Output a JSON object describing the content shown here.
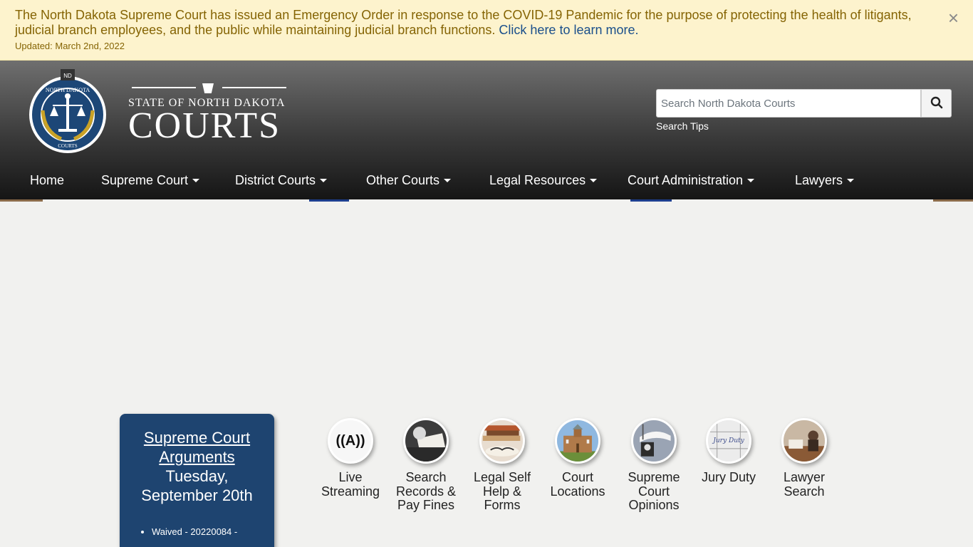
{
  "alert": {
    "message": "The North Dakota Supreme Court has issued an Emergency Order in response to the COVID-19 Pandemic for the purpose of protecting the health of litigants, judicial branch employees, and the public while maintaining judicial branch functions.",
    "link_text": "Click here to learn more.",
    "updated": "Updated: March 2nd, 2022",
    "close_glyph": "×"
  },
  "logo": {
    "seal_top": "NORTH DAKOTA",
    "seal_bottom": "COURTS",
    "seal_badge": "ND",
    "state_line": "STATE OF NORTH DAKOTA",
    "courts_line": "COURTS"
  },
  "search": {
    "placeholder": "Search North Dakota Courts",
    "tips": "Search Tips",
    "icon": "search-icon"
  },
  "nav": [
    {
      "label": "Home",
      "dropdown": false
    },
    {
      "label": "Supreme Court",
      "dropdown": true
    },
    {
      "label": "District Courts",
      "dropdown": true
    },
    {
      "label": "Other Courts",
      "dropdown": true
    },
    {
      "label": "Legal Resources",
      "dropdown": true
    },
    {
      "label": "Court Administration",
      "dropdown": true
    },
    {
      "label": "Lawyers",
      "dropdown": true
    }
  ],
  "arguments_card": {
    "title": "Supreme Court Arguments",
    "date": "Tuesday, September 20th",
    "items": [
      "Waived - 20220084 -"
    ]
  },
  "quick_links": [
    {
      "label": "Live Streaming",
      "icon": "live-streaming-icon",
      "glyph": "((A))"
    },
    {
      "label": "Search Records & Pay Fines",
      "icon": "records-icon"
    },
    {
      "label": "Legal Self Help & Forms",
      "icon": "books-icon"
    },
    {
      "label": "Court Locations",
      "icon": "courthouse-icon"
    },
    {
      "label": "Supreme Court Opinions",
      "icon": "opinions-icon"
    },
    {
      "label": "Jury Duty",
      "icon": "calendar-icon",
      "glyph": "Jury Duty"
    },
    {
      "label": "Lawyer Search",
      "icon": "lawyer-icon"
    }
  ],
  "colors": {
    "alert_bg": "#fdf3cd",
    "alert_text": "#856404",
    "link": "#1a4f8b",
    "card_bg": "#1e4470",
    "seal_blue": "#1d4777",
    "seal_gold": "#c9a227"
  }
}
